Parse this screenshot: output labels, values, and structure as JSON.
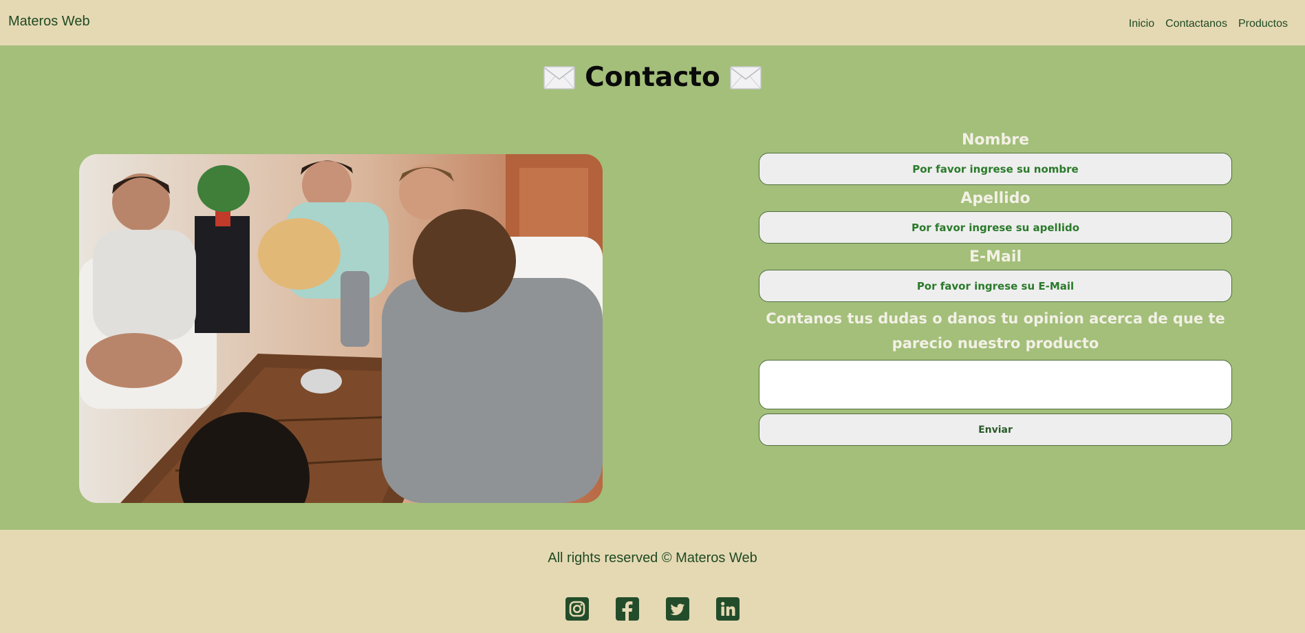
{
  "navbar": {
    "brand": "Materos Web",
    "links": [
      "Inicio",
      "Contactanos",
      "Productos"
    ]
  },
  "main": {
    "title": "Contacto",
    "icons": {
      "title_left": "envelope-icon",
      "title_right": "envelope-icon"
    },
    "photo": "group-of-friends-sharing-mate-photo"
  },
  "form": {
    "nombre_label": "Nombre",
    "nombre_placeholder": "Por favor ingrese su nombre",
    "apellido_label": "Apellido",
    "apellido_placeholder": "Por favor ingrese su apellido",
    "email_label": "E-Mail",
    "email_placeholder": "Por favor ingrese su E-Mail",
    "message_label": "Contanos tus dudas o danos tu opinion acerca de que te parecio nuestro producto",
    "message_value": "",
    "submit_label": "Enviar"
  },
  "footer": {
    "copyright": "All rights reserved © Materos Web",
    "socials": [
      "instagram-icon",
      "facebook-icon",
      "twitter-icon",
      "linkedin-icon"
    ]
  },
  "colors": {
    "page_bg": "#e5d9b4",
    "main_bg": "#a3bf7a",
    "brand_text": "#1f4a22",
    "placeholder_text": "#2a7a2a"
  }
}
